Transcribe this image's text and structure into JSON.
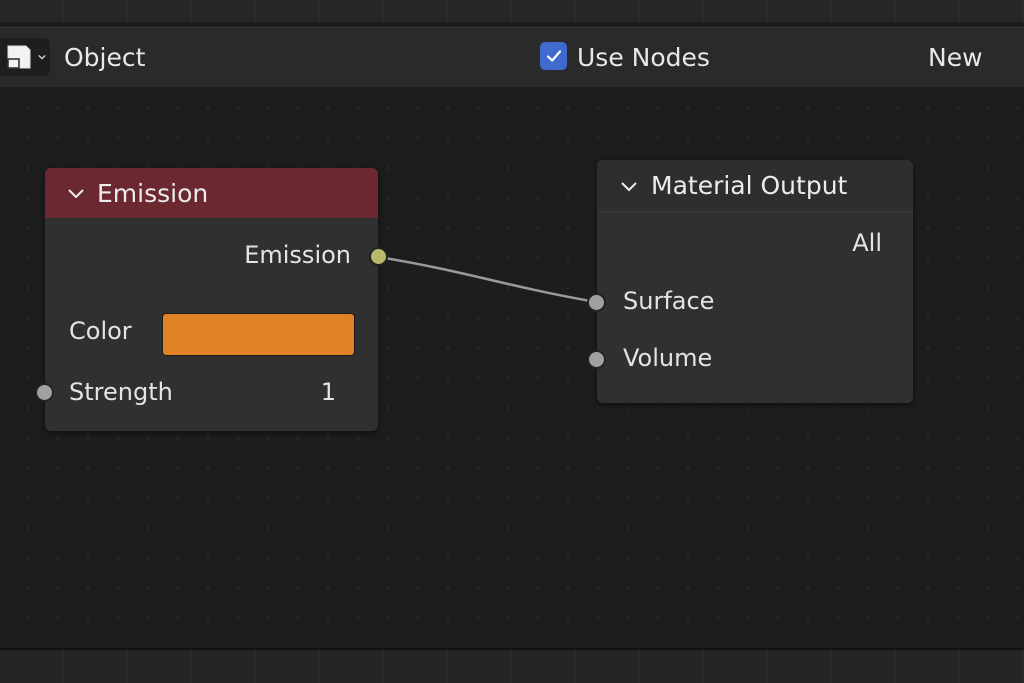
{
  "header": {
    "editor_type_icon": "node-editor-icon",
    "shader_type": "Object",
    "use_nodes_label": "Use Nodes",
    "use_nodes_checked": true,
    "new_button": "New"
  },
  "nodes": {
    "emission": {
      "title": "Emission",
      "header_color": "#6b2830",
      "output_label": "Emission",
      "output_socket_color": "#b9b96a",
      "color_label": "Color",
      "color_value": "#e08327",
      "strength_label": "Strength",
      "strength_value": "1"
    },
    "material_output": {
      "title": "Material Output",
      "target": "All",
      "surface_label": "Surface",
      "volume_label": "Volume"
    }
  },
  "colors": {
    "checkbox": "#3f6bd0",
    "socket_gray": "#a0a0a0",
    "link": "#9a9a9a"
  }
}
